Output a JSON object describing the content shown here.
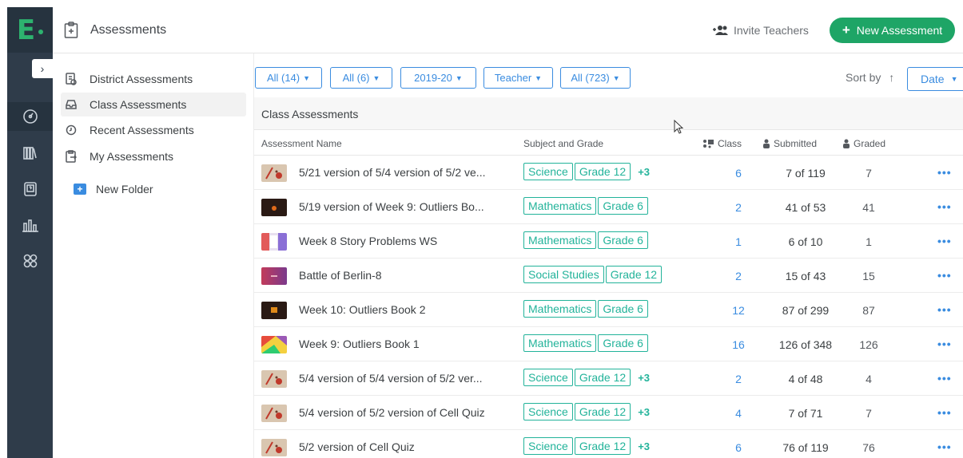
{
  "app": {
    "logo_letter": "E",
    "brand_color": "#2db36f",
    "accent_color": "#3a8ce0",
    "tag_color": "#22b39a"
  },
  "rail": {
    "collapse_glyph": "›",
    "items": [
      {
        "icon": "gauge-icon"
      },
      {
        "icon": "library-icon"
      },
      {
        "icon": "question-card-icon"
      },
      {
        "icon": "bar-chart-icon"
      },
      {
        "icon": "apps-icon"
      }
    ]
  },
  "topbar": {
    "title": "Assessments",
    "invite_label": "Invite Teachers",
    "new_label": "New Assessment"
  },
  "sidebar": {
    "items": [
      {
        "label": "District Assessments"
      },
      {
        "label": "Class Assessments"
      },
      {
        "label": "Recent Assessments"
      },
      {
        "label": "My Assessments"
      }
    ],
    "new_folder": "New Folder"
  },
  "filters": [
    "All (14)",
    "All (6)",
    "2019-20",
    "Teacher",
    "All (723)"
  ],
  "sort": {
    "label": "Sort by",
    "value": "Date"
  },
  "table": {
    "title": "Class Assessments",
    "headers": {
      "name": "Assessment Name",
      "subject": "Subject and Grade",
      "class": "Class",
      "submitted": "Submitted",
      "graded": "Graded"
    },
    "more": "•••",
    "rows": [
      {
        "name": "5/21 version of 5/4 version of 5/2 ve...",
        "subject": "Science",
        "grade": "Grade 12",
        "extra": "+3",
        "class": "6",
        "submitted": "7 of 119",
        "graded": "7",
        "thumb": "bio"
      },
      {
        "name": "5/19 version of Week 9: Outliers Bo...",
        "subject": "Mathematics",
        "grade": "Grade 6",
        "extra": "",
        "class": "2",
        "submitted": "41 of 53",
        "graded": "41",
        "thumb": "dark"
      },
      {
        "name": "Week 8 Story Problems WS",
        "subject": "Mathematics",
        "grade": "Grade 6",
        "extra": "",
        "class": "1",
        "submitted": "6 of 10",
        "graded": "1",
        "thumb": "story"
      },
      {
        "name": "Battle of Berlin-8",
        "subject": "Social Studies",
        "grade": "Grade 12",
        "extra": "",
        "class": "2",
        "submitted": "15 of 43",
        "graded": "15",
        "thumb": "berlin"
      },
      {
        "name": "Week 10: Outliers Book 2",
        "subject": "Mathematics",
        "grade": "Grade 6",
        "extra": "",
        "class": "12",
        "submitted": "87 of 299",
        "graded": "87",
        "thumb": "dark2"
      },
      {
        "name": "Week 9: Outliers Book 1",
        "subject": "Mathematics",
        "grade": "Grade 6",
        "extra": "",
        "class": "16",
        "submitted": "126 of 348",
        "graded": "126",
        "thumb": "colorful"
      },
      {
        "name": "5/4 version of 5/4 version of 5/2 ver...",
        "subject": "Science",
        "grade": "Grade 12",
        "extra": "+3",
        "class": "2",
        "submitted": "4 of 48",
        "graded": "4",
        "thumb": "bio"
      },
      {
        "name": "5/4 version of 5/2 version of Cell Quiz",
        "subject": "Science",
        "grade": "Grade 12",
        "extra": "+3",
        "class": "4",
        "submitted": "7 of 71",
        "graded": "7",
        "thumb": "bio"
      },
      {
        "name": "5/2 version of Cell Quiz",
        "subject": "Science",
        "grade": "Grade 12",
        "extra": "+3",
        "class": "6",
        "submitted": "76 of 119",
        "graded": "76",
        "thumb": "bio"
      }
    ]
  }
}
